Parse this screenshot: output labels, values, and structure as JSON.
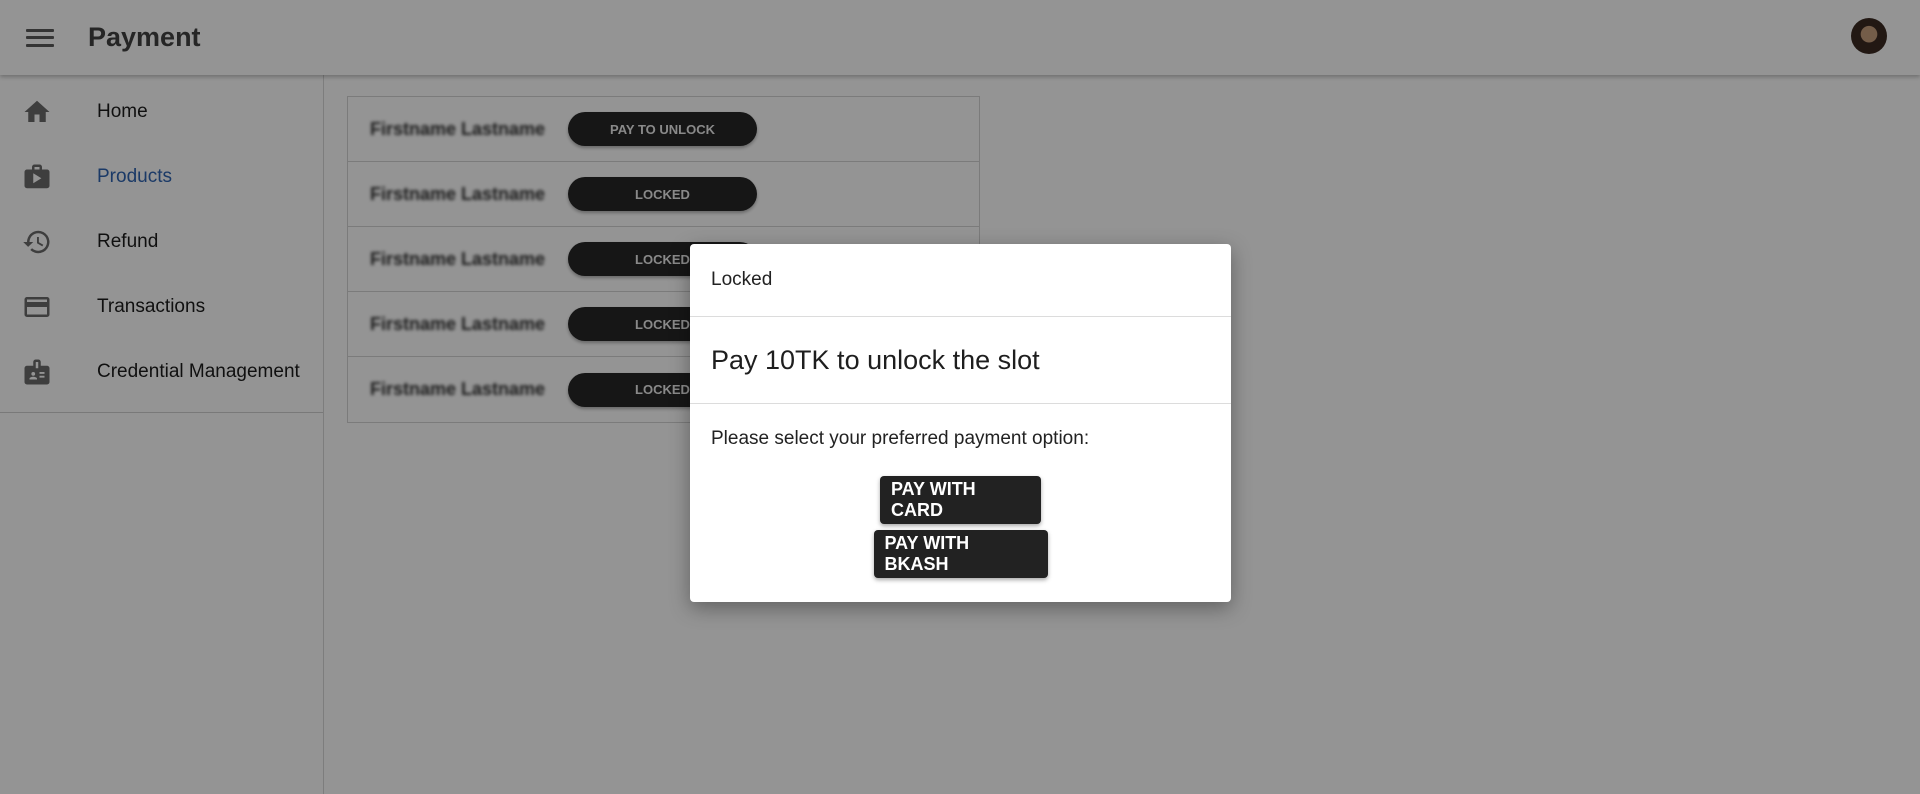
{
  "appbar": {
    "title": "Payment"
  },
  "sidebar": {
    "items": [
      {
        "label": "Home",
        "icon": "home-icon",
        "active": false
      },
      {
        "label": "Products",
        "icon": "product-icon",
        "active": true
      },
      {
        "label": "Refund",
        "icon": "history-icon",
        "active": false
      },
      {
        "label": "Transactions",
        "icon": "credit-card-icon",
        "active": false
      },
      {
        "label": "Credential Management",
        "icon": "badge-icon",
        "active": false
      }
    ]
  },
  "list": {
    "rows": [
      {
        "name": "Firstname Lastname",
        "action": "PAY TO UNLOCK"
      },
      {
        "name": "Firstname Lastname",
        "action": "LOCKED"
      },
      {
        "name": "Firstname Lastname",
        "action": "LOCKED"
      },
      {
        "name": "Firstname Lastname",
        "action": "LOCKED"
      },
      {
        "name": "Firstname Lastname",
        "action": "LOCKED"
      }
    ]
  },
  "dialog": {
    "header": "Locked",
    "title": "Pay 10TK to unlock the slot",
    "message": "Please select your preferred payment option:",
    "buttons": {
      "card": "PAY WITH CARD",
      "bkash": "PAY WITH BKASH"
    }
  },
  "colors": {
    "accent": "#2f64b2",
    "button": "#222222",
    "overlay": "rgba(0,0,0,0.42)"
  }
}
